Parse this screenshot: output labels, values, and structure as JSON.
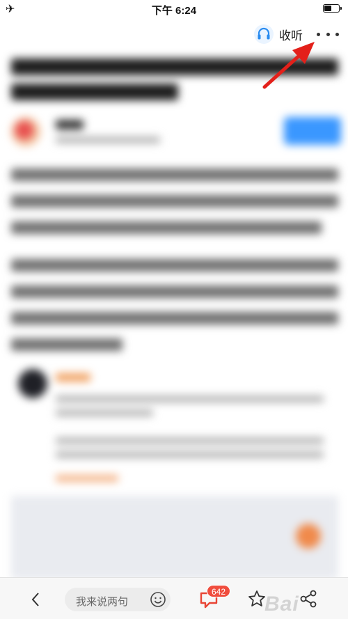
{
  "status_bar": {
    "time": "下午 6:24",
    "airplane_icon": "airplane-icon",
    "battery_level": 0.45
  },
  "header": {
    "listen_label": "收听",
    "listen_icon": "headphones-icon",
    "more_icon": "more-dots-icon"
  },
  "bottom_bar": {
    "comment_placeholder": "我来说两句",
    "comment_count": "642",
    "icons": [
      "back-icon",
      "emoji-icon",
      "comment-icon",
      "star-icon",
      "share-icon"
    ]
  },
  "watermark": "Bai",
  "colors": {
    "accent_blue": "#3a97ff",
    "badge_red": "#f04d3e",
    "arrow_red": "#e3201a"
  }
}
